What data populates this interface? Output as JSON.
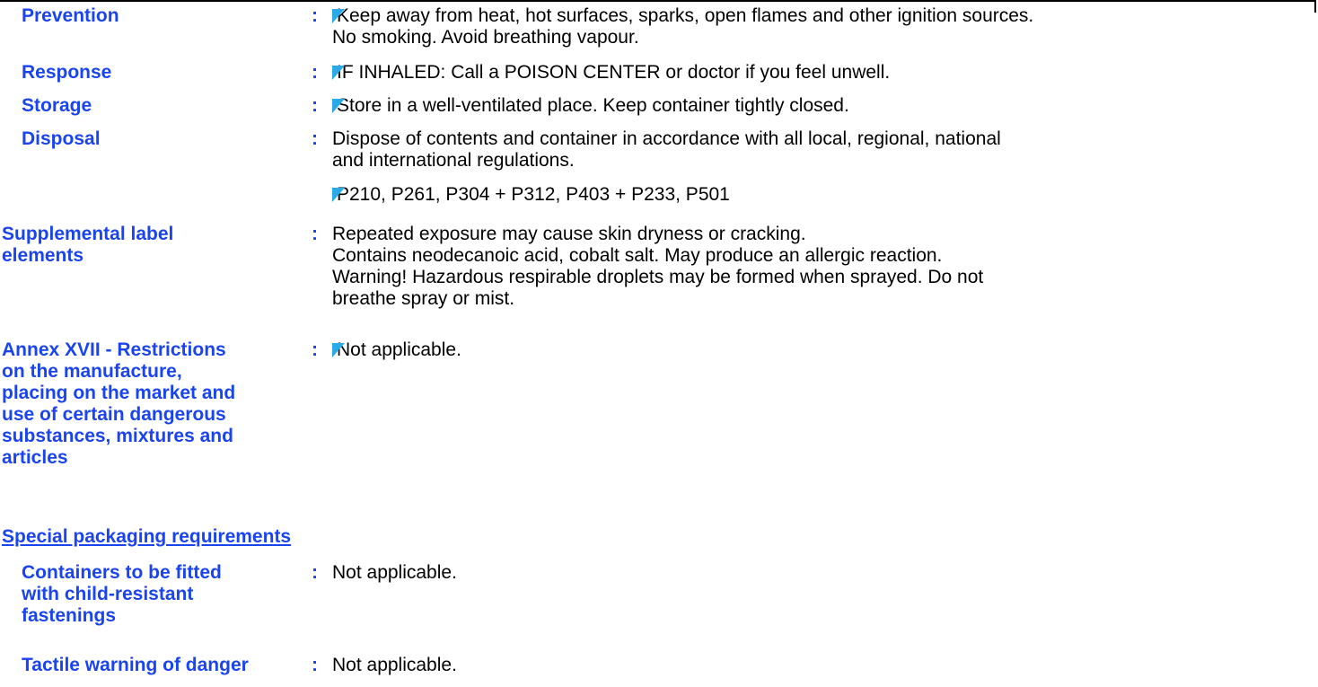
{
  "rows": [
    {
      "label": "Prevention",
      "lines": [
        "Keep away from heat, hot surfaces, sparks, open flames and other ignition sources.",
        "No smoking.  Avoid breathing vapour."
      ]
    },
    {
      "label": "Response",
      "lines": [
        "IF INHALED: Call a POISON CENTER or doctor if you feel unwell."
      ]
    },
    {
      "label": "Storage",
      "lines": [
        "Store in a well-ventilated place. Keep container tightly closed."
      ]
    },
    {
      "label": "Disposal",
      "lines": [
        "Dispose of contents and container in accordance with all local, regional, national",
        "and international regulations."
      ],
      "codes": "P210, P261, P304 + P312, P403 + P233, P501"
    },
    {
      "label_lines": [
        "Supplemental label",
        "elements"
      ],
      "lines": [
        "Repeated exposure may cause skin dryness or cracking.",
        "Contains neodecanoic acid, cobalt salt. May produce an allergic reaction.",
        "Warning! Hazardous respirable droplets may be formed when sprayed. Do not",
        "breathe spray or mist."
      ]
    },
    {
      "label_lines": [
        "Annex XVII - Restrictions",
        "on the manufacture,",
        "placing on the market and",
        "use of certain dangerous",
        "substances, mixtures and",
        "articles"
      ],
      "lines": [
        "Not applicable."
      ]
    }
  ],
  "colon": ":",
  "section_heading": "Special packaging requirements",
  "packaging": [
    {
      "label_lines": [
        "Containers to be fitted",
        "with child-resistant",
        "fastenings"
      ],
      "value": "Not applicable."
    },
    {
      "label": "Tactile warning of danger",
      "value": "Not applicable."
    }
  ],
  "colors": {
    "label": "#1a44f0",
    "marker": "#29a9e6",
    "text": "#000000"
  }
}
